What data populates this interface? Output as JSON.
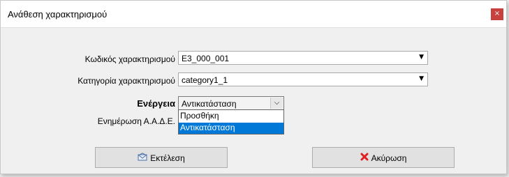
{
  "window": {
    "title": "Ανάθεση χαρακτηρισμού",
    "close_glyph": "×"
  },
  "form": {
    "code_label": "Κωδικός χαρακτηρισμού",
    "code_value": "E3_000_001",
    "category_label": "Κατηγορία χαρακτηρισμού",
    "category_value": "category1_1",
    "action_label": "Ενέργεια",
    "action_value": "Αντικατάσταση",
    "action_options": [
      "Προσθήκη",
      "Αντικατάσταση"
    ],
    "update_label": "Ενημέρωση Α.Α.Δ.Ε."
  },
  "buttons": {
    "execute_label": "Εκτέλεση",
    "cancel_label": "Ακύρωση"
  },
  "icons": {
    "dropdown_arrow": "▼",
    "chevron": "⌵",
    "execute_icon": "envelope-icon",
    "cancel_icon": "x-mark-icon"
  },
  "colors": {
    "selection": "#0078d7",
    "close_button": "#c7413f",
    "cancel_icon": "#e02020"
  }
}
